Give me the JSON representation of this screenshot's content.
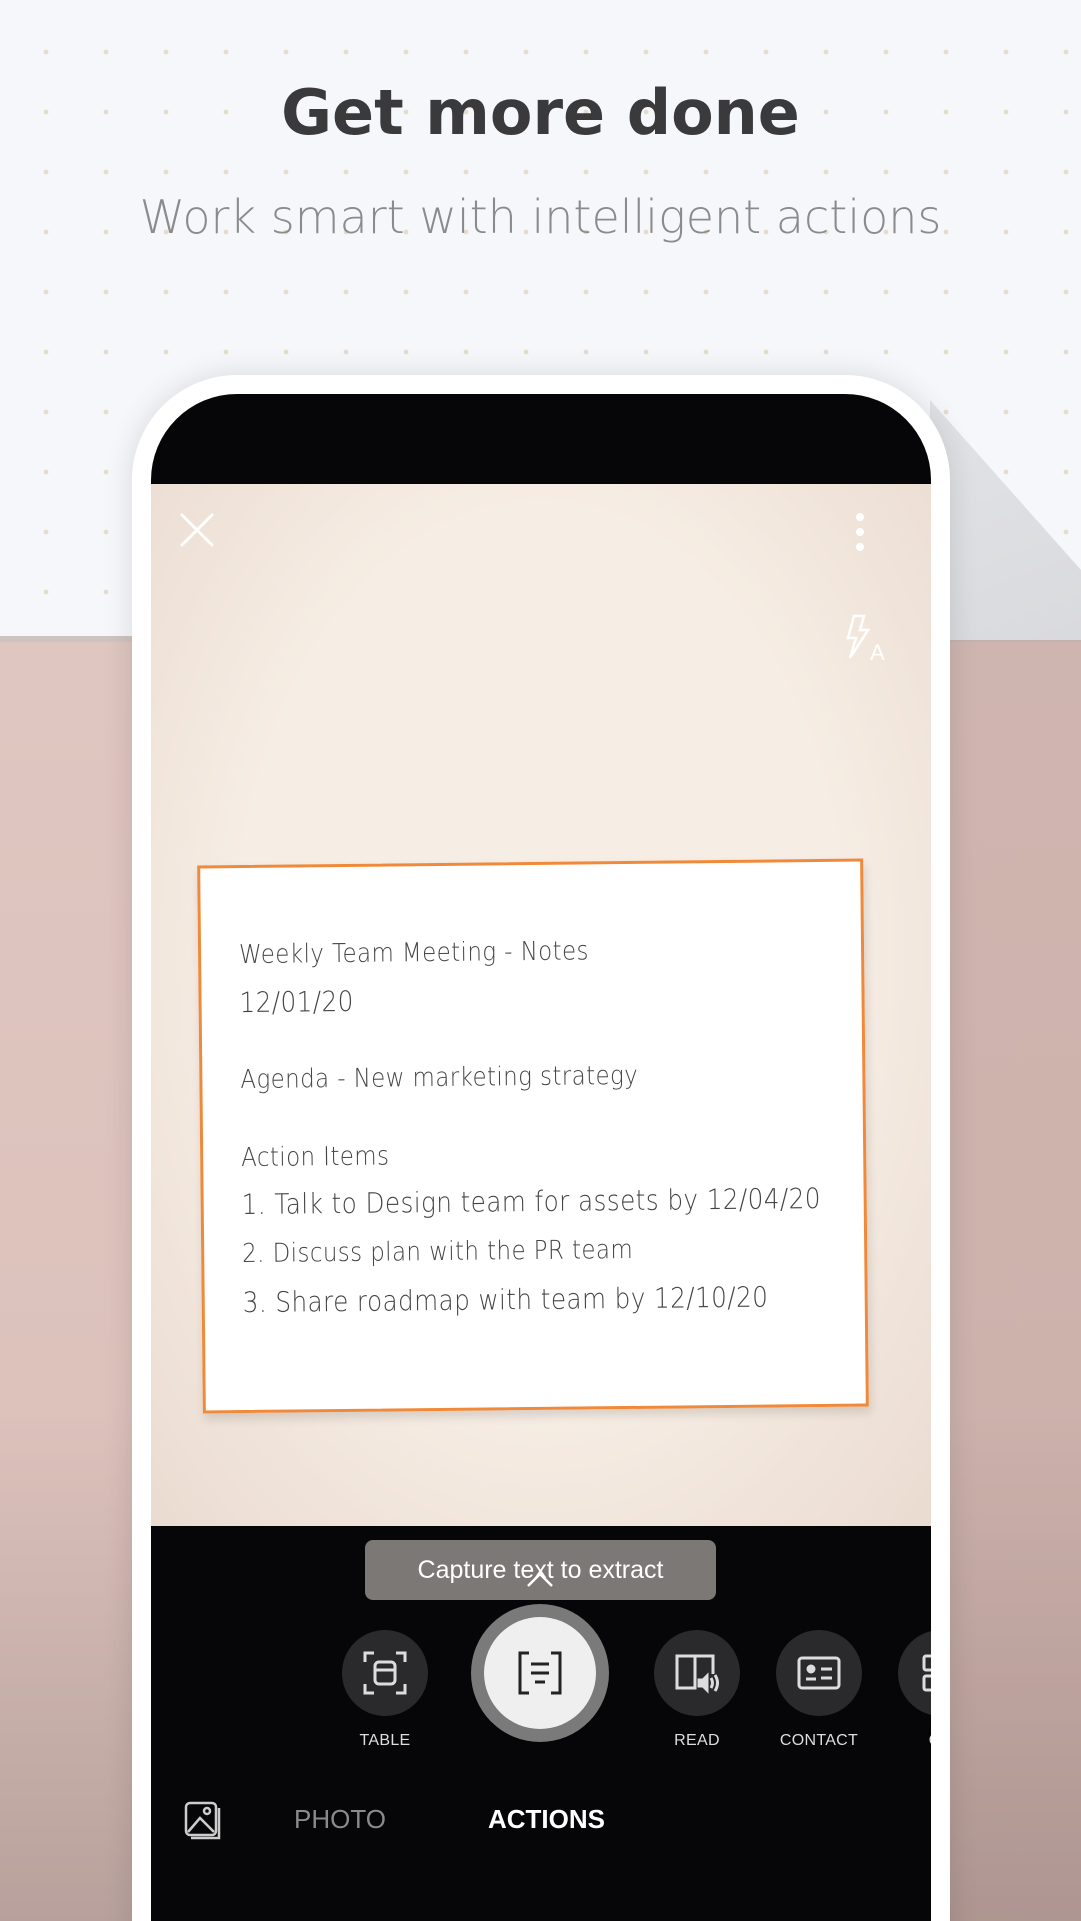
{
  "header": {
    "title": "Get more done",
    "subtitle": "Work smart with intelligent actions"
  },
  "camera": {
    "note_lines": [
      "Weekly Team Meeting - Notes",
      "12/01/20",
      "Agenda - New marketing strategy",
      "Action Items",
      "1. Talk to Design team for assets by 12/04/20",
      "2. Discuss plan with the PR team",
      "3. Share roadmap with team by 12/10/20"
    ],
    "hint": "Capture text to extract",
    "border_color": "#f08a3a"
  },
  "actions": [
    {
      "label": "TABLE",
      "icon": "table-icon"
    },
    {
      "label": "",
      "icon": "text-extract-icon",
      "selected": true
    },
    {
      "label": "READ",
      "icon": "read-aloud-icon"
    },
    {
      "label": "CONTACT",
      "icon": "contact-card-icon"
    },
    {
      "label": "QR",
      "icon": "qr-icon"
    }
  ],
  "modes": {
    "photo": "PHOTO",
    "actions": "ACTIONS",
    "active": "ACTIONS"
  }
}
